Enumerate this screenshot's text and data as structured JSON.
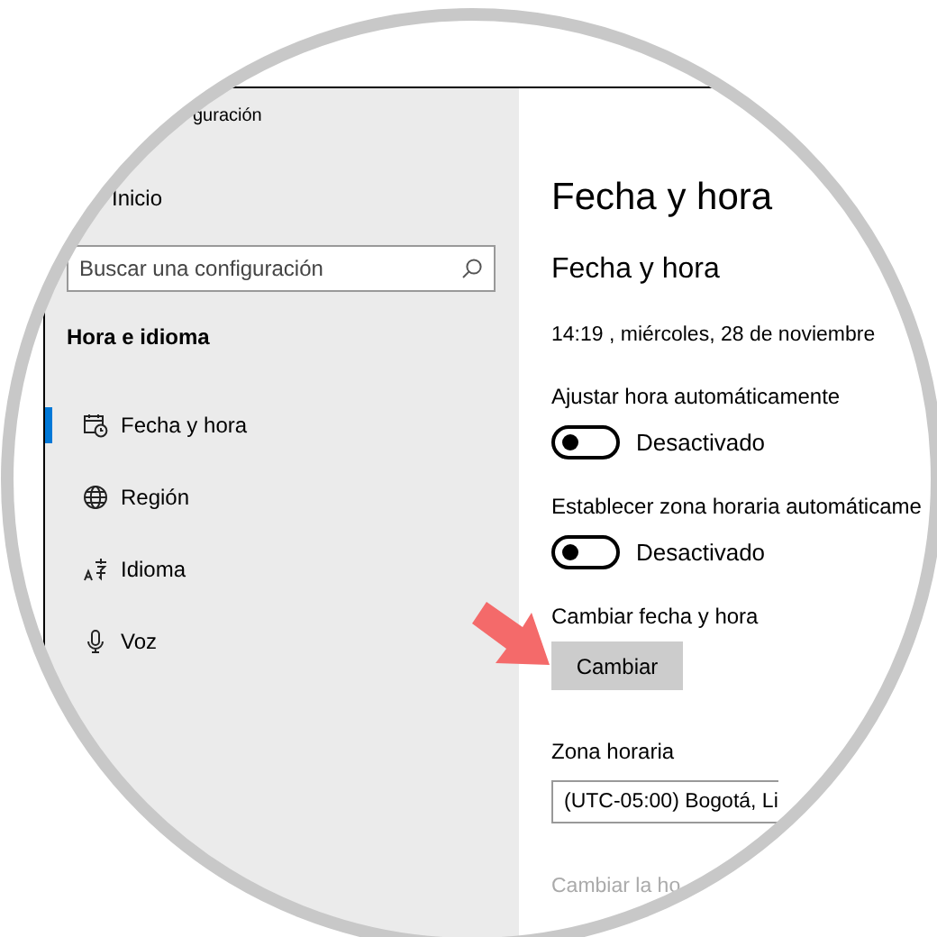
{
  "window": {
    "title": "guración"
  },
  "sidebar": {
    "home": "Inicio",
    "search": {
      "placeholder": "Buscar una configuración"
    },
    "section": "Hora e idioma",
    "items": [
      {
        "kind": "date",
        "label": "Fecha y hora",
        "selected": true
      },
      {
        "kind": "region",
        "label": "Región",
        "selected": false
      },
      {
        "kind": "language",
        "label": "Idioma",
        "selected": false
      },
      {
        "kind": "speech",
        "label": "Voz",
        "selected": false
      }
    ]
  },
  "content": {
    "title": "Fecha y hora",
    "heading": "Fecha y hora",
    "current": "14:19 , miércoles, 28 de noviembre",
    "settings": [
      {
        "kind": "toggle",
        "label": "Ajustar hora automáticamente",
        "on": false,
        "disabled": false,
        "state": "Desactivado"
      },
      {
        "kind": "toggle",
        "label": "Establecer zona horaria automáticame",
        "on": false,
        "disabled": false,
        "state": "Desactivado"
      },
      {
        "kind": "button",
        "label": "Cambiar fecha y hora",
        "button": "Cambiar"
      },
      {
        "kind": "dropdown",
        "label": "Zona horaria",
        "value": "(UTC-05:00) Bogotá, Li"
      },
      {
        "kind": "note",
        "label": "Cambiar la ho",
        "disabled": true
      }
    ]
  }
}
